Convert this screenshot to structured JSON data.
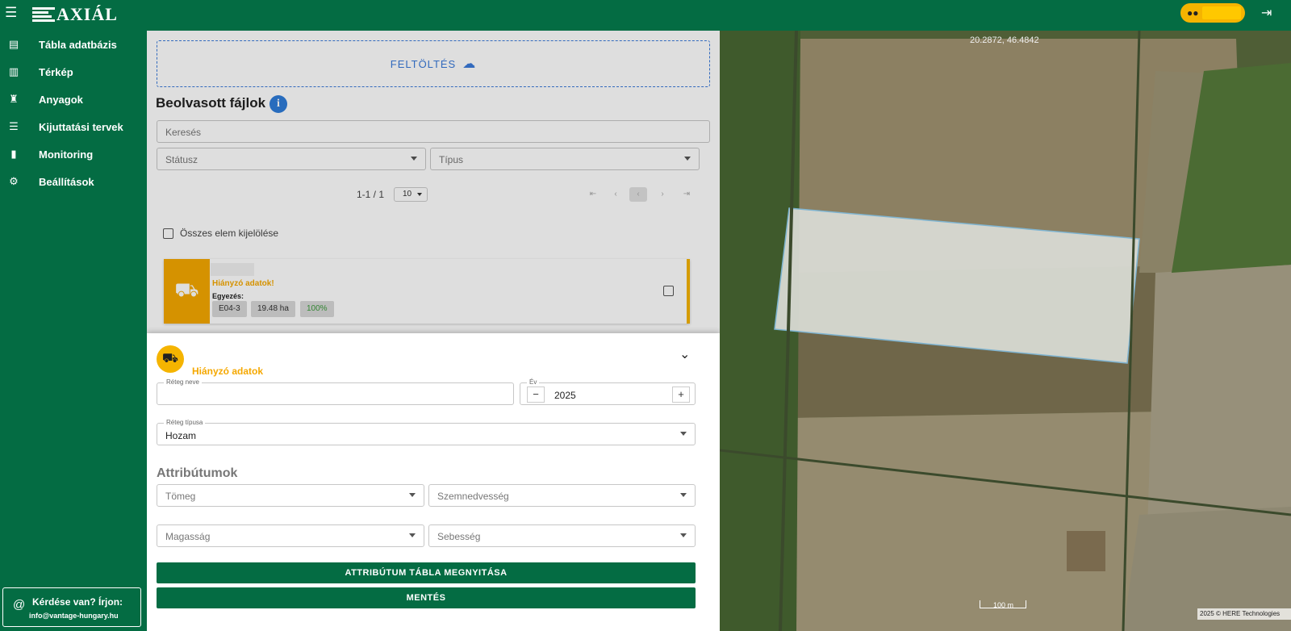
{
  "header": {
    "logo_text": "AXIÁL",
    "menu_icon": "hamburger-icon",
    "user_icon": "users-icon",
    "logout_icon": "logout-icon",
    "brand_color": "#046c43",
    "accent_color": "#f5b400"
  },
  "sidebar": {
    "items": [
      {
        "label": "Tábla adatbázis",
        "icon": "database-icon"
      },
      {
        "label": "Térkép",
        "icon": "map-icon"
      },
      {
        "label": "Anyagok",
        "icon": "bag-icon"
      },
      {
        "label": "Kijuttatási tervek",
        "icon": "list-icon"
      },
      {
        "label": "Monitoring",
        "icon": "bar-chart-icon"
      },
      {
        "label": "Beállítások",
        "icon": "gear-icon"
      }
    ],
    "help": {
      "title": "Kérdése van? Írjon:",
      "email": "info@vantage-hungary.hu"
    }
  },
  "main": {
    "upload_label": "FELTÖLTÉS",
    "section_title": "Beolvasott fájlok",
    "search_placeholder": "Keresés",
    "status_placeholder": "Státusz",
    "type_placeholder": "Típus",
    "pagination": {
      "range": "1-1 / 1",
      "page_size": "10"
    },
    "select_all_label": "Összes elem kijelölése",
    "file_card": {
      "warning": "Hiányzó adatok!",
      "match_label": "Egyezés:",
      "chips": [
        "E04-3",
        "19.48 ha",
        "100%"
      ]
    }
  },
  "panel": {
    "title": "Hiányzó adatok",
    "layer_name_label": "Réteg neve",
    "layer_name_value": "",
    "year_label": "Év",
    "year_value": "2025",
    "minus": "−",
    "plus": "+",
    "layer_type_label": "Réteg típusa",
    "layer_type_value": "Hozam",
    "attributes_title": "Attribútumok",
    "attr_fields": [
      "Tömeg",
      "Szemnedvesség",
      "Magasság",
      "Sebesség"
    ],
    "open_table_button": "ATTRIBÚTUM TÁBLA MEGNYITÁSA",
    "save_button": "MENTÉS"
  },
  "map": {
    "coordinates": "20.2872, 46.4842",
    "scale_label": "100 m",
    "attribution": "2025 © HERE Technologies"
  }
}
